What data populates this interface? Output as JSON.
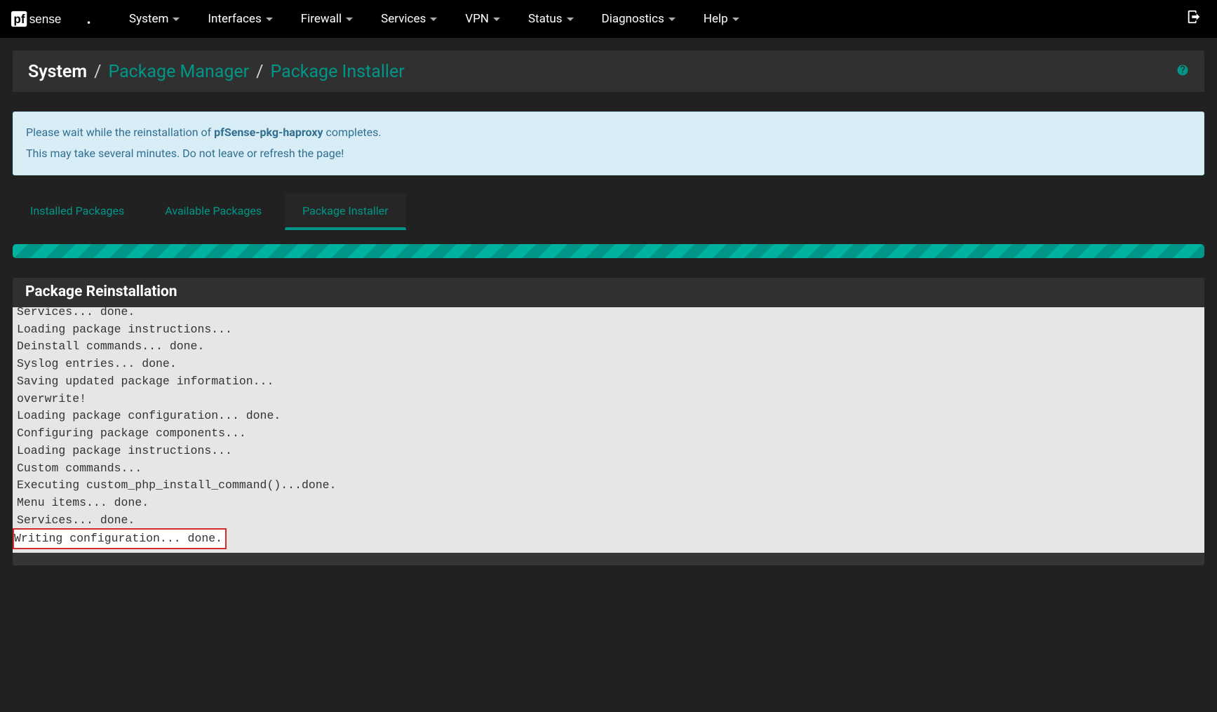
{
  "brand": {
    "name": "pfSense"
  },
  "nav": {
    "items": [
      "System",
      "Interfaces",
      "Firewall",
      "Services",
      "VPN",
      "Status",
      "Diagnostics",
      "Help"
    ]
  },
  "breadcrumb": {
    "root": "System",
    "mid": "Package Manager",
    "leaf": "Package Installer",
    "sep": "/"
  },
  "alert": {
    "line1_pre": "Please wait while the reinstallation of ",
    "line1_pkg": "pfSense-pkg-haproxy",
    "line1_post": " completes.",
    "line2": "This may take several minutes. Do not leave or refresh the page!"
  },
  "tabs": {
    "items": [
      "Installed Packages",
      "Available Packages",
      "Package Installer"
    ],
    "active_index": 2
  },
  "panel": {
    "title": "Package Reinstallation"
  },
  "log": {
    "lines": [
      "Services... done.",
      "Loading package instructions...",
      "Deinstall commands... done.",
      "Syslog entries... done.",
      "Saving updated package information...",
      "overwrite!",
      "Loading package configuration... done.",
      "Configuring package components...",
      "Loading package instructions...",
      "Custom commands...",
      "Executing custom_php_install_command()...done.",
      "Menu items... done.",
      "Services... done."
    ],
    "highlighted_line": "Writing configuration... done."
  }
}
